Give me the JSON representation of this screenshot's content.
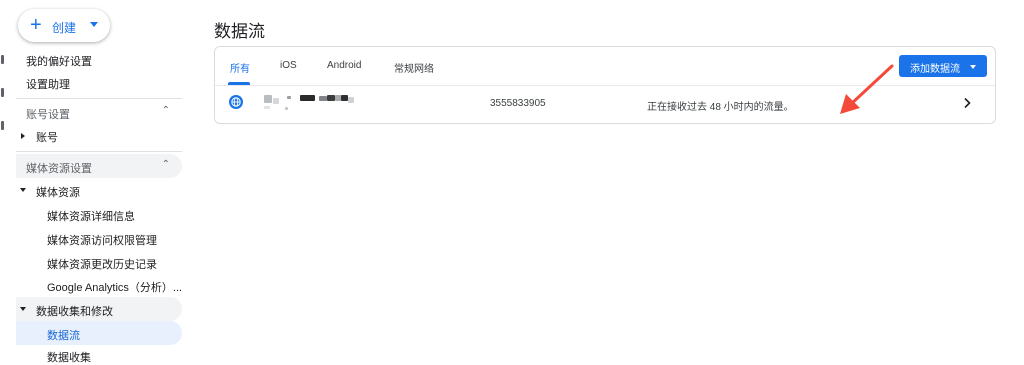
{
  "sidebar": {
    "create_label": "创建",
    "items": {
      "preferences": "我的偏好设置",
      "setup_assistant": "设置助理"
    },
    "account_section": {
      "title": "账号设置",
      "account": "账号"
    },
    "property_section": {
      "title": "媒体资源设置",
      "property": "媒体资源",
      "property_details": "媒体资源详细信息",
      "property_access": "媒体资源访问权限管理",
      "property_history": "媒体资源更改历史记录",
      "google_analytics": "Google Analytics（分析）...",
      "data_collection_group": "数据收集和修改",
      "data_streams": "数据流",
      "data_collection": "数据收集"
    }
  },
  "main": {
    "title": "数据流",
    "tabs": [
      {
        "label": "所有",
        "active": true
      },
      {
        "label": "iOS",
        "active": false
      },
      {
        "label": "Android",
        "active": false
      },
      {
        "label": "常规网络",
        "active": false
      }
    ],
    "add_stream_label": "添加数据流",
    "streams": [
      {
        "type_icon": "web-globe-icon",
        "stream_id": "3555833905",
        "status": "正在接收过去 48 小时内的流量。"
      }
    ]
  },
  "annotation": {
    "arrow_color": "#f44a3a"
  },
  "colors": {
    "accent": "#1a73e8",
    "active_nav_bg": "#e8f0fe",
    "section_bg": "#f1f3f4"
  }
}
